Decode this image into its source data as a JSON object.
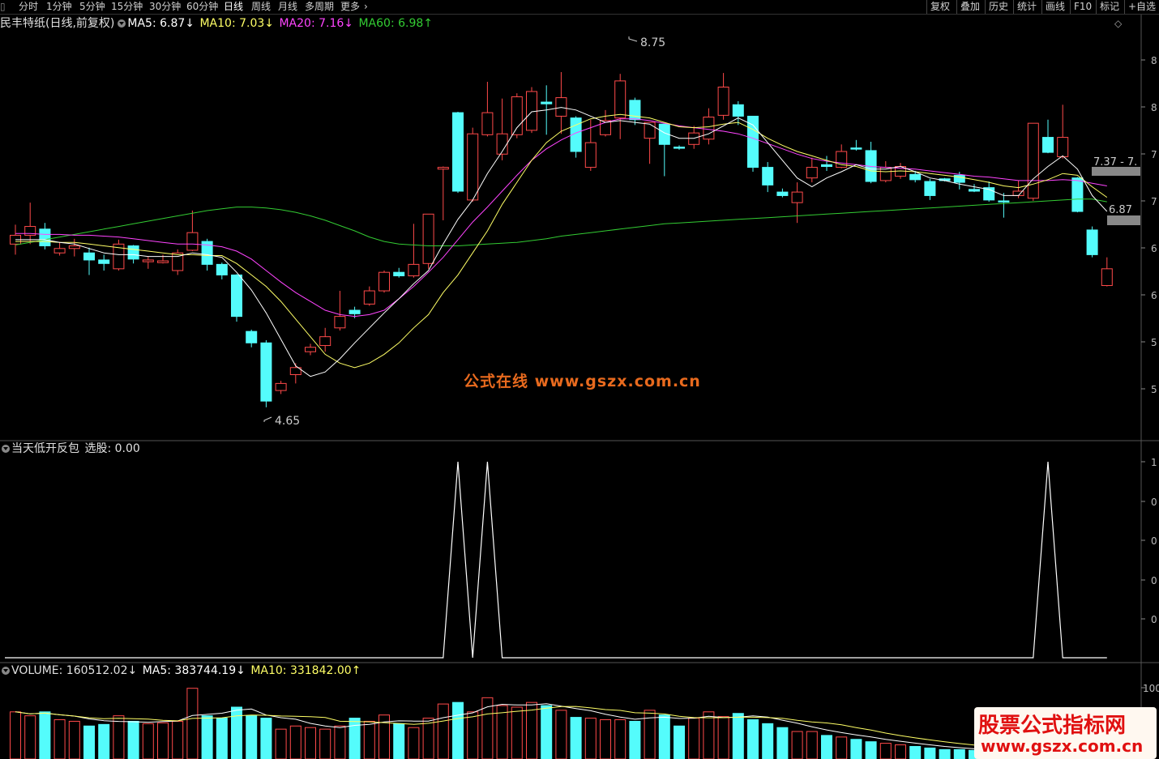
{
  "toolbar": {
    "periods": [
      "分时",
      "1分钟",
      "5分钟",
      "15分钟",
      "30分钟",
      "60分钟",
      "日线",
      "周线",
      "月线",
      "多周期",
      "更多"
    ],
    "active_period": "日线",
    "right_buttons": [
      "复权",
      "叠加",
      "历史",
      "统计",
      "画线",
      "F10",
      "标记",
      "+自选"
    ]
  },
  "main_legend": {
    "stock": "民丰特纸(日线,前复权)",
    "ma5": "MA5: 6.87↓",
    "ma10": "MA10: 7.03↓",
    "ma20": "MA20: 7.16↓",
    "ma60": "MA60: 6.98↑"
  },
  "indicator_legend": {
    "name": "当天低开反包",
    "value": "选股: 0.00"
  },
  "volume_legend": {
    "vol": "VOLUME: 160512.02↓",
    "ma5": "MA5: 383744.19↓",
    "ma10": "MA10: 331842.00↑"
  },
  "annotations": {
    "high": "8.75",
    "low": "4.65",
    "range1": "7.37 - 7.",
    "range2": "6.87"
  },
  "right_axis": {
    "price_ticks": [
      "8",
      "8",
      "7",
      "7",
      "6",
      "6",
      "5",
      "5"
    ],
    "ind_ticks": [
      "1",
      "0",
      "0",
      "0",
      "0"
    ],
    "vol_ticks": [
      "100"
    ]
  },
  "watermarks": {
    "center": "公式在线  www.gszx.com.cn",
    "corner_line1": "股票公式指标网",
    "corner_line2": "www.gszx.com.cn"
  },
  "colors": {
    "up": "#ff4a4a",
    "down": "#54fcfc",
    "ma5": "#ffffff",
    "ma10": "#ffff66",
    "ma20": "#ff44ff",
    "ma60": "#33cc33"
  },
  "chart_data": {
    "type": "candlestick",
    "price_range": [
      4.4,
      8.9
    ],
    "candles": [
      {
        "o": 6.5,
        "c": 6.6,
        "h": 6.72,
        "l": 6.38
      },
      {
        "o": 6.6,
        "c": 6.7,
        "h": 6.97,
        "l": 6.5
      },
      {
        "o": 6.67,
        "c": 6.48,
        "h": 6.74,
        "l": 6.44
      },
      {
        "o": 6.4,
        "c": 6.45,
        "h": 6.52,
        "l": 6.37
      },
      {
        "o": 6.45,
        "c": 6.48,
        "h": 6.56,
        "l": 6.36
      },
      {
        "o": 6.4,
        "c": 6.32,
        "h": 6.46,
        "l": 6.15
      },
      {
        "o": 6.32,
        "c": 6.28,
        "h": 6.38,
        "l": 6.2
      },
      {
        "o": 6.22,
        "c": 6.5,
        "h": 6.55,
        "l": 6.2
      },
      {
        "o": 6.48,
        "c": 6.33,
        "h": 6.49,
        "l": 6.28
      },
      {
        "o": 6.3,
        "c": 6.32,
        "h": 6.36,
        "l": 6.22
      },
      {
        "o": 6.29,
        "c": 6.31,
        "h": 6.38,
        "l": 6.28
      },
      {
        "o": 6.2,
        "c": 6.4,
        "h": 6.44,
        "l": 6.15
      },
      {
        "o": 6.43,
        "c": 6.63,
        "h": 6.88,
        "l": 6.42
      },
      {
        "o": 6.53,
        "c": 6.27,
        "h": 6.56,
        "l": 6.2
      },
      {
        "o": 6.27,
        "c": 6.15,
        "h": 6.29,
        "l": 6.1
      },
      {
        "o": 6.15,
        "c": 5.68,
        "h": 6.16,
        "l": 5.62
      },
      {
        "o": 5.51,
        "c": 5.38,
        "h": 5.53,
        "l": 5.33
      },
      {
        "o": 5.38,
        "c": 4.72,
        "h": 5.41,
        "l": 4.65
      },
      {
        "o": 4.84,
        "c": 4.92,
        "h": 4.95,
        "l": 4.8
      },
      {
        "o": 5.02,
        "c": 5.1,
        "h": 5.15,
        "l": 4.92
      },
      {
        "o": 5.28,
        "c": 5.33,
        "h": 5.37,
        "l": 5.24
      },
      {
        "o": 5.35,
        "c": 5.45,
        "h": 5.55,
        "l": 5.28
      },
      {
        "o": 5.55,
        "c": 5.68,
        "h": 5.97,
        "l": 5.52
      },
      {
        "o": 5.75,
        "c": 5.71,
        "h": 5.79,
        "l": 5.66
      },
      {
        "o": 5.82,
        "c": 5.97,
        "h": 6.02,
        "l": 5.8
      },
      {
        "o": 5.97,
        "c": 6.18,
        "h": 6.2,
        "l": 5.95
      },
      {
        "o": 6.18,
        "c": 6.14,
        "h": 6.23,
        "l": 6.12
      },
      {
        "o": 6.14,
        "c": 6.27,
        "h": 6.73,
        "l": 6.12
      },
      {
        "o": 6.28,
        "c": 6.84,
        "h": 6.84,
        "l": 6.22
      },
      {
        "o": 7.35,
        "c": 7.37,
        "h": 7.38,
        "l": 6.77
      },
      {
        "o": 7.99,
        "c": 7.1,
        "h": 8.0,
        "l": 7.08
      },
      {
        "o": 7.0,
        "c": 7.75,
        "h": 7.82,
        "l": 6.98
      },
      {
        "o": 7.74,
        "c": 7.99,
        "h": 8.34,
        "l": 7.72
      },
      {
        "o": 7.52,
        "c": 7.75,
        "h": 8.15,
        "l": 7.45
      },
      {
        "o": 7.74,
        "c": 8.17,
        "h": 8.21,
        "l": 7.7
      },
      {
        "o": 7.79,
        "c": 8.23,
        "h": 8.28,
        "l": 7.76
      },
      {
        "o": 8.11,
        "c": 8.09,
        "h": 8.3,
        "l": 7.74
      },
      {
        "o": 7.95,
        "c": 8.16,
        "h": 8.45,
        "l": 7.75
      },
      {
        "o": 7.93,
        "c": 7.55,
        "h": 7.95,
        "l": 7.48
      },
      {
        "o": 7.37,
        "c": 7.65,
        "h": 7.91,
        "l": 7.33
      },
      {
        "o": 7.74,
        "c": 7.9,
        "h": 8.02,
        "l": 7.72
      },
      {
        "o": 7.93,
        "c": 8.35,
        "h": 8.43,
        "l": 7.69
      },
      {
        "o": 8.13,
        "c": 7.91,
        "h": 8.16,
        "l": 7.85
      },
      {
        "o": 7.7,
        "c": 7.88,
        "h": 7.88,
        "l": 7.41
      },
      {
        "o": 7.86,
        "c": 7.63,
        "h": 7.86,
        "l": 7.27
      },
      {
        "o": 7.6,
        "c": 7.59,
        "h": 7.62,
        "l": 7.57
      },
      {
        "o": 7.63,
        "c": 7.76,
        "h": 7.84,
        "l": 7.58
      },
      {
        "o": 7.69,
        "c": 7.94,
        "h": 8.04,
        "l": 7.63
      },
      {
        "o": 7.96,
        "c": 8.28,
        "h": 8.44,
        "l": 7.91
      },
      {
        "o": 8.08,
        "c": 7.95,
        "h": 8.12,
        "l": 7.85
      },
      {
        "o": 7.95,
        "c": 7.37,
        "h": 7.95,
        "l": 7.32
      },
      {
        "o": 7.37,
        "c": 7.17,
        "h": 7.43,
        "l": 7.09
      },
      {
        "o": 7.09,
        "c": 7.05,
        "h": 7.13,
        "l": 7.03
      },
      {
        "o": 6.97,
        "c": 7.09,
        "h": 7.2,
        "l": 6.74
      },
      {
        "o": 7.25,
        "c": 7.37,
        "h": 7.48,
        "l": 7.2
      },
      {
        "o": 7.4,
        "c": 7.38,
        "h": 7.5,
        "l": 7.33
      },
      {
        "o": 7.37,
        "c": 7.55,
        "h": 7.63,
        "l": 7.36
      },
      {
        "o": 7.59,
        "c": 7.58,
        "h": 7.68,
        "l": 7.56
      },
      {
        "o": 7.56,
        "c": 7.21,
        "h": 7.66,
        "l": 7.19
      },
      {
        "o": 7.22,
        "c": 7.37,
        "h": 7.44,
        "l": 7.2
      },
      {
        "o": 7.27,
        "c": 7.38,
        "h": 7.42,
        "l": 7.24
      },
      {
        "o": 7.29,
        "c": 7.23,
        "h": 7.33,
        "l": 7.2
      },
      {
        "o": 7.21,
        "c": 7.05,
        "h": 7.24,
        "l": 7.0
      },
      {
        "o": 7.24,
        "c": 7.22,
        "h": 7.25,
        "l": 7.21
      },
      {
        "o": 7.28,
        "c": 7.2,
        "h": 7.32,
        "l": 7.12
      },
      {
        "o": 7.12,
        "c": 7.1,
        "h": 7.18,
        "l": 7.09
      },
      {
        "o": 7.14,
        "c": 7.0,
        "h": 7.21,
        "l": 6.98
      },
      {
        "o": 6.99,
        "c": 6.98,
        "h": 7.08,
        "l": 6.8
      },
      {
        "o": 7.05,
        "c": 7.1,
        "h": 7.22,
        "l": 7.02
      },
      {
        "o": 7.02,
        "c": 7.87,
        "h": 7.87,
        "l": 6.99
      },
      {
        "o": 7.71,
        "c": 7.54,
        "h": 7.91,
        "l": 7.53
      },
      {
        "o": 7.49,
        "c": 7.71,
        "h": 8.08,
        "l": 7.47
      },
      {
        "o": 7.25,
        "c": 6.87,
        "h": 7.26,
        "l": 6.86
      },
      {
        "o": 6.66,
        "c": 6.38,
        "h": 6.7,
        "l": 6.35
      },
      {
        "o": 6.03,
        "c": 6.22,
        "h": 6.35,
        "l": 6.02
      }
    ],
    "ma5": [
      6.55,
      6.55,
      6.55,
      6.52,
      6.5,
      6.45,
      6.4,
      6.38,
      6.38,
      6.36,
      6.36,
      6.36,
      6.4,
      6.38,
      6.35,
      6.18,
      5.98,
      5.72,
      5.42,
      5.12,
      5.0,
      5.05,
      5.2,
      5.38,
      5.55,
      5.72,
      5.88,
      6.05,
      6.2,
      6.5,
      6.78,
      7.0,
      7.3,
      7.55,
      7.82,
      8.0,
      8.02,
      8.05,
      8.02,
      7.95,
      7.88,
      7.9,
      7.88,
      7.86,
      7.76,
      7.7,
      7.7,
      7.75,
      7.84,
      7.93,
      7.85,
      7.65,
      7.45,
      7.25,
      7.15,
      7.25,
      7.32,
      7.4,
      7.35,
      7.35,
      7.38,
      7.32,
      7.25,
      7.22,
      7.18,
      7.15,
      7.12,
      7.05,
      7.05,
      7.24,
      7.38,
      7.5,
      7.35,
      7.05,
      6.87
    ],
    "ma10": [
      6.53,
      6.53,
      6.53,
      6.52,
      6.52,
      6.5,
      6.48,
      6.46,
      6.44,
      6.42,
      6.4,
      6.38,
      6.38,
      6.37,
      6.37,
      6.28,
      6.15,
      6.02,
      5.85,
      5.65,
      5.45,
      5.25,
      5.15,
      5.1,
      5.15,
      5.25,
      5.38,
      5.55,
      5.7,
      5.95,
      6.15,
      6.4,
      6.65,
      6.95,
      7.2,
      7.45,
      7.65,
      7.78,
      7.85,
      7.92,
      7.95,
      7.97,
      7.95,
      7.93,
      7.88,
      7.83,
      7.82,
      7.83,
      7.86,
      7.88,
      7.8,
      7.7,
      7.62,
      7.55,
      7.5,
      7.45,
      7.4,
      7.38,
      7.33,
      7.32,
      7.33,
      7.32,
      7.3,
      7.28,
      7.26,
      7.23,
      7.2,
      7.16,
      7.14,
      7.18,
      7.23,
      7.3,
      7.28,
      7.15,
      7.03
    ],
    "ma20": [
      6.62,
      6.62,
      6.61,
      6.61,
      6.6,
      6.6,
      6.59,
      6.58,
      6.56,
      6.54,
      6.52,
      6.5,
      6.5,
      6.49,
      6.47,
      6.42,
      6.33,
      6.2,
      6.07,
      5.95,
      5.85,
      5.75,
      5.7,
      5.68,
      5.7,
      5.75,
      5.88,
      6.02,
      6.18,
      6.35,
      6.55,
      6.75,
      6.92,
      7.1,
      7.28,
      7.45,
      7.58,
      7.68,
      7.76,
      7.82,
      7.88,
      7.92,
      7.92,
      7.9,
      7.87,
      7.84,
      7.82,
      7.8,
      7.78,
      7.75,
      7.7,
      7.64,
      7.58,
      7.52,
      7.47,
      7.44,
      7.42,
      7.4,
      7.38,
      7.37,
      7.36,
      7.35,
      7.33,
      7.31,
      7.29,
      7.27,
      7.26,
      7.24,
      7.22,
      7.22,
      7.22,
      7.23,
      7.22,
      7.19,
      7.16
    ],
    "ma60": [
      6.49,
      6.52,
      6.55,
      6.58,
      6.61,
      6.64,
      6.67,
      6.7,
      6.73,
      6.76,
      6.79,
      6.82,
      6.85,
      6.88,
      6.9,
      6.92,
      6.92,
      6.91,
      6.89,
      6.86,
      6.82,
      6.77,
      6.71,
      6.65,
      6.58,
      6.53,
      6.5,
      6.49,
      6.48,
      6.48,
      6.48,
      6.49,
      6.5,
      6.51,
      6.52,
      6.54,
      6.56,
      6.59,
      6.61,
      6.63,
      6.65,
      6.67,
      6.69,
      6.71,
      6.73,
      6.74,
      6.75,
      6.76,
      6.77,
      6.78,
      6.79,
      6.8,
      6.81,
      6.82,
      6.83,
      6.84,
      6.85,
      6.86,
      6.87,
      6.88,
      6.89,
      6.9,
      6.91,
      6.92,
      6.93,
      6.94,
      6.95,
      6.96,
      6.97,
      6.98,
      6.99,
      7.0,
      7.01,
      7.01,
      6.98
    ],
    "signal": [
      0,
      0,
      0,
      0,
      0,
      0,
      0,
      0,
      0,
      0,
      0,
      0,
      0,
      0,
      0,
      0,
      0,
      0,
      0,
      0,
      0,
      0,
      0,
      0,
      0,
      0,
      0,
      0,
      0,
      0,
      1,
      0,
      1,
      0,
      0,
      0,
      0,
      0,
      0,
      0,
      0,
      0,
      0,
      0,
      0,
      0,
      0,
      0,
      0,
      0,
      0,
      0,
      0,
      0,
      0,
      0,
      0,
      0,
      0,
      0,
      0,
      0,
      0,
      0,
      0,
      0,
      0,
      0,
      0,
      0,
      1,
      0,
      0,
      0,
      0
    ],
    "volume": [
      60,
      55,
      60,
      50,
      48,
      42,
      44,
      55,
      48,
      45,
      46,
      48,
      90,
      55,
      52,
      66,
      55,
      52,
      38,
      42,
      40,
      38,
      42,
      52,
      48,
      56,
      45,
      40,
      52,
      70,
      72,
      60,
      78,
      68,
      66,
      72,
      68,
      62,
      53,
      52,
      50,
      50,
      48,
      62,
      56,
      42,
      52,
      60,
      54,
      58,
      50,
      45,
      40,
      35,
      35,
      30,
      28,
      25,
      22,
      20,
      18,
      16,
      14,
      12,
      12,
      11,
      10,
      10,
      9,
      10,
      9,
      9,
      8,
      8,
      7
    ]
  }
}
